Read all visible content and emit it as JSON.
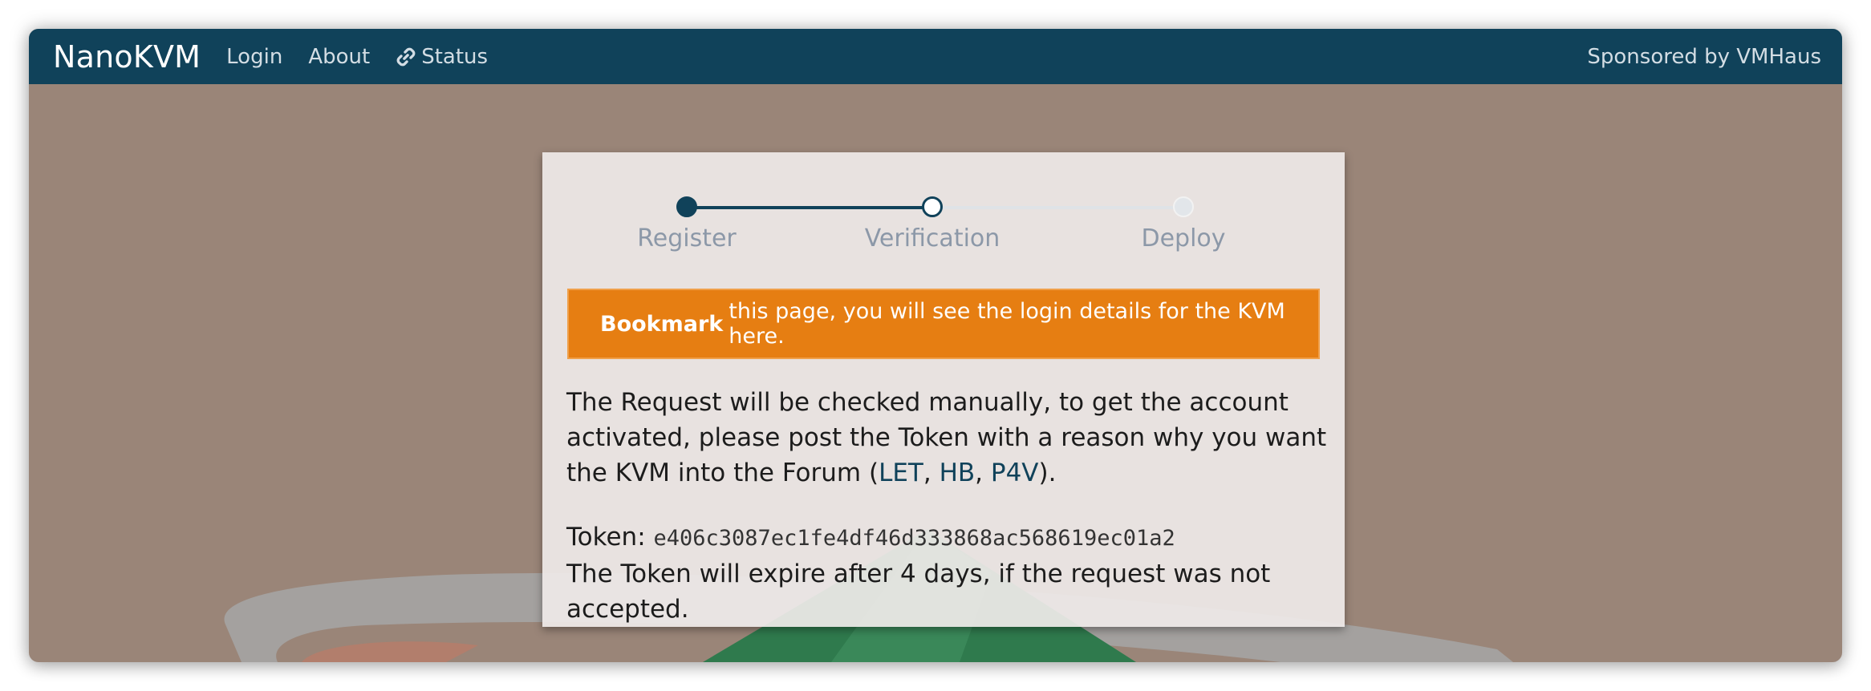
{
  "navbar": {
    "brand": "NanoKVM",
    "items": [
      {
        "label": "Login"
      },
      {
        "label": "About"
      },
      {
        "label": "Status",
        "icon": "link-icon"
      }
    ],
    "sponsor": "Sponsored by VMHaus"
  },
  "steps": [
    {
      "label": "Register",
      "state": "complete"
    },
    {
      "label": "Verification",
      "state": "current"
    },
    {
      "label": "Deploy",
      "state": "pending"
    }
  ],
  "alert": {
    "bold": "Bookmark",
    "text": "this page, you will see the login details for the KVM here."
  },
  "message": {
    "line_text": "The Request will be checked manually, to get the account activated, please post the Token with a reason why you want the KVM into the Forum (",
    "links": [
      "LET",
      "HB",
      "P4V"
    ],
    "separator": ", ",
    "suffix": ")."
  },
  "token": {
    "label": "Token:",
    "value": "e406c3087ec1fe4df46d333868ac568619ec01a2",
    "expiry_text": "The Token will expire after 4 days, if the request was not accepted."
  },
  "colors": {
    "navbar": "#10425a",
    "accent": "#e67e12",
    "background": "#9a8578",
    "link": "#10425a"
  }
}
